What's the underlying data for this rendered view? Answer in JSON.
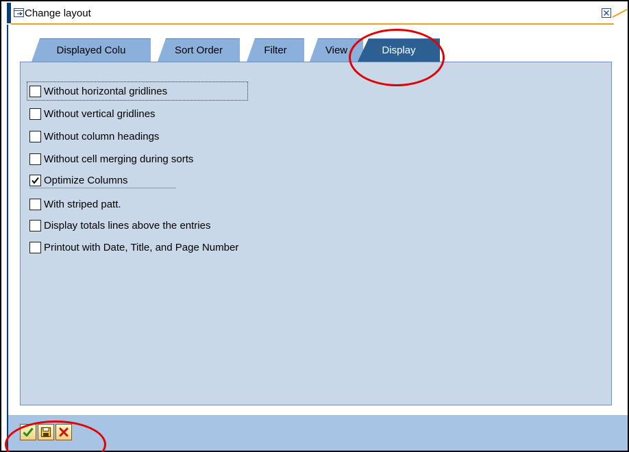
{
  "window": {
    "title": "Change layout"
  },
  "tabs": [
    {
      "label": "Displayed Colu",
      "active": false
    },
    {
      "label": "Sort Order",
      "active": false
    },
    {
      "label": "Filter",
      "active": false
    },
    {
      "label": "View",
      "active": false
    },
    {
      "label": "Display",
      "active": true
    }
  ],
  "options": [
    {
      "label": "Without horizontal gridlines",
      "checked": false
    },
    {
      "label": "Without vertical gridlines",
      "checked": false
    },
    {
      "label": "Without column headings",
      "checked": false
    },
    {
      "label": "Without cell merging during sorts",
      "checked": false
    },
    {
      "label": "Optimize Columns",
      "checked": true
    },
    {
      "label": "With striped patt.",
      "checked": false
    },
    {
      "label": "Display totals lines above the entries",
      "checked": false
    },
    {
      "label": "Printout with Date, Title, and Page Number",
      "checked": false
    }
  ],
  "toolbar": {
    "buttons": [
      {
        "name": "confirm-button",
        "icon": "checkmark-icon"
      },
      {
        "name": "save-button",
        "icon": "floppy-disk-icon"
      },
      {
        "name": "cancel-button",
        "icon": "cross-icon"
      }
    ]
  },
  "colors": {
    "panel": "#c8d8e8",
    "active_tab": "#2c5f92",
    "inactive_tab": "#8cb0dc",
    "bottom_bar": "#a8c4e4",
    "annotation_red": "#e00000"
  }
}
